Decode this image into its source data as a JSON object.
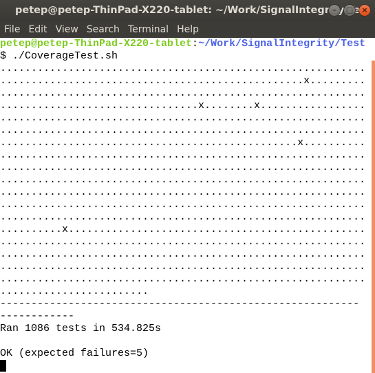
{
  "window": {
    "title": "petep@petep-ThinPad-X220-tablet: ~/Work/SignalIntegrity/Test",
    "buttons": {
      "minimize": "–",
      "maximize": "□",
      "close": "×"
    }
  },
  "menu": [
    "File",
    "Edit",
    "View",
    "Search",
    "Terminal",
    "Help"
  ],
  "prompt": {
    "user_host": "petep@petep-ThinPad-X220-tablet",
    "sep": ":",
    "path": "~/Work/SignalIntegrity/Test",
    "symbol": "$ ",
    "command": "./CoverageTest.sh"
  },
  "output_lines": [
    "...........................................................",
    ".................................................x.........",
    "...........................................................",
    "................................x........x.................",
    "...........................................................",
    "...........................................................",
    "................................................x..........",
    "...........................................................",
    "...........................................................",
    "...........................................................",
    "...........................................................",
    "...........................................................",
    "...........................................................",
    "..........x................................................",
    "...........................................................",
    "...........................................................",
    "...........................................................",
    "...........................................................",
    "........................"
  ],
  "separator": "----------------------------------------------------------------------",
  "summary": "Ran 1086 tests in 534.825s",
  "result": "OK (expected failures=5)",
  "colors": {
    "scrollbar": "#f08e63",
    "prompt_user": "#7ecb20",
    "prompt_path": "#4e63e6"
  }
}
